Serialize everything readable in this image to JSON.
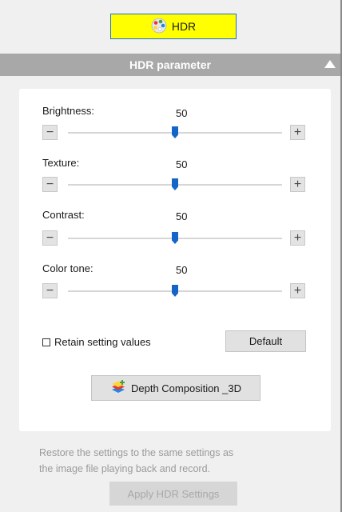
{
  "hdr_button": {
    "label": "HDR",
    "icon": "palette-icon",
    "background": "#ffff00",
    "border": "#1e6fd0"
  },
  "section": {
    "title": "HDR parameter",
    "collapse_icon": "triangle-up-icon"
  },
  "parameters": [
    {
      "label": "Brightness:",
      "value": "50",
      "level": 0.5
    },
    {
      "label": "Texture:",
      "value": "50",
      "level": 0.5
    },
    {
      "label": "Contrast:",
      "value": "50",
      "level": 0.5
    },
    {
      "label": "Color tone:",
      "value": "50",
      "level": 0.5
    }
  ],
  "stepper": {
    "minus": "−",
    "plus": "+"
  },
  "retain": {
    "label": "Retain setting values",
    "checked": false
  },
  "default_button": "Default",
  "depth_button": {
    "label": "Depth Composition _3D",
    "icon": "layers-icon"
  },
  "info_text": {
    "line1": "Restore the settings to the same settings as",
    "line2": "the image file playing back and record."
  },
  "apply_button": {
    "label": "Apply HDR Settings",
    "disabled": true
  },
  "accent_color": "#1565c8"
}
